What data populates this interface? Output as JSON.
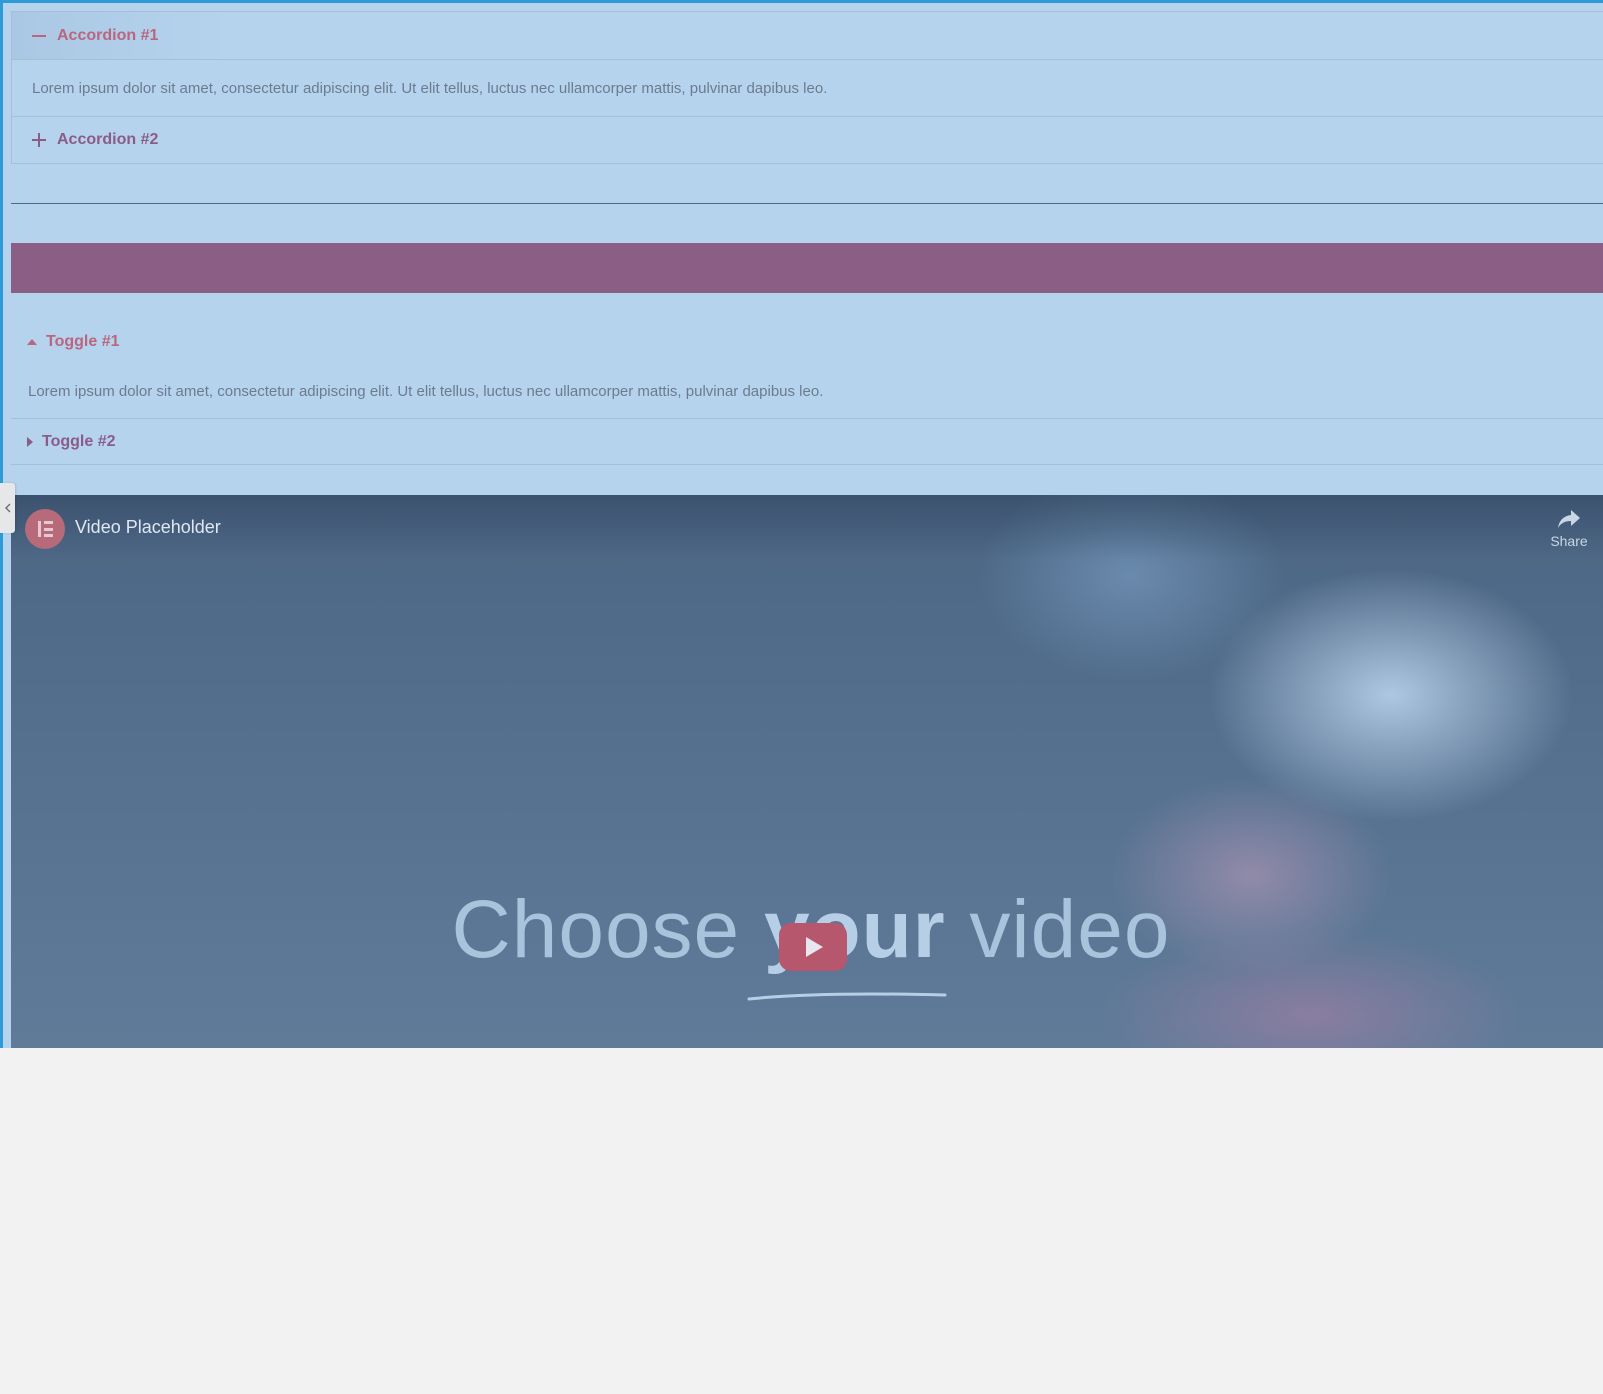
{
  "accordion": {
    "items": [
      {
        "title": "Accordion #1",
        "expanded": true,
        "icon": "minus-icon"
      },
      {
        "title": "Accordion #2",
        "expanded": false,
        "icon": "plus-icon"
      }
    ],
    "content": "Lorem ipsum dolor sit amet, consectetur adipiscing elit. Ut elit tellus, luctus nec ullamcorper mattis, pulvinar dapibus leo."
  },
  "toggle": {
    "items": [
      {
        "title": "Toggle #1",
        "expanded": true,
        "icon": "caret-up-icon"
      },
      {
        "title": "Toggle #2",
        "expanded": false,
        "icon": "caret-right-icon"
      }
    ],
    "content": "Lorem ipsum dolor sit amet, consectetur adipiscing elit. Ut elit tellus, luctus nec ullamcorper mattis, pulvinar dapibus leo."
  },
  "video": {
    "title": "Video Placeholder",
    "share_label": "Share",
    "thumbnail_text": {
      "before": "Choose ",
      "emphasis": "your",
      "after": " video"
    },
    "icons": {
      "channel": "elementor-logo-icon",
      "share": "share-arrow-icon",
      "play": "play-icon"
    }
  },
  "colors": {
    "selection_overlay": "#b6d3ee",
    "selection_border": "#2e9bd8",
    "active_title": "#b9667e",
    "inactive_title": "#8a5c88",
    "purple_bar": "#8b5f85",
    "body_text": "#6b7c8f",
    "canvas": "#f2f2f2"
  },
  "editor": {
    "panel_toggle_icon": "chevron-left-icon"
  }
}
